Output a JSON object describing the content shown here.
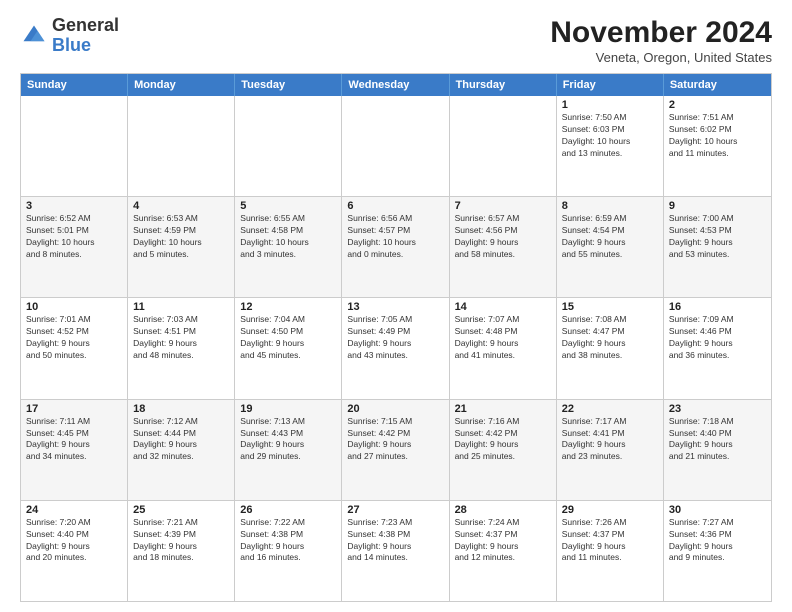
{
  "logo": {
    "general": "General",
    "blue": "Blue"
  },
  "title": "November 2024",
  "subtitle": "Veneta, Oregon, United States",
  "days": [
    "Sunday",
    "Monday",
    "Tuesday",
    "Wednesday",
    "Thursday",
    "Friday",
    "Saturday"
  ],
  "rows": [
    {
      "alt": false,
      "cells": [
        {
          "day": "",
          "info": ""
        },
        {
          "day": "",
          "info": ""
        },
        {
          "day": "",
          "info": ""
        },
        {
          "day": "",
          "info": ""
        },
        {
          "day": "",
          "info": ""
        },
        {
          "day": "1",
          "info": "Sunrise: 7:50 AM\nSunset: 6:03 PM\nDaylight: 10 hours\nand 13 minutes."
        },
        {
          "day": "2",
          "info": "Sunrise: 7:51 AM\nSunset: 6:02 PM\nDaylight: 10 hours\nand 11 minutes."
        }
      ]
    },
    {
      "alt": true,
      "cells": [
        {
          "day": "3",
          "info": "Sunrise: 6:52 AM\nSunset: 5:01 PM\nDaylight: 10 hours\nand 8 minutes."
        },
        {
          "day": "4",
          "info": "Sunrise: 6:53 AM\nSunset: 4:59 PM\nDaylight: 10 hours\nand 5 minutes."
        },
        {
          "day": "5",
          "info": "Sunrise: 6:55 AM\nSunset: 4:58 PM\nDaylight: 10 hours\nand 3 minutes."
        },
        {
          "day": "6",
          "info": "Sunrise: 6:56 AM\nSunset: 4:57 PM\nDaylight: 10 hours\nand 0 minutes."
        },
        {
          "day": "7",
          "info": "Sunrise: 6:57 AM\nSunset: 4:56 PM\nDaylight: 9 hours\nand 58 minutes."
        },
        {
          "day": "8",
          "info": "Sunrise: 6:59 AM\nSunset: 4:54 PM\nDaylight: 9 hours\nand 55 minutes."
        },
        {
          "day": "9",
          "info": "Sunrise: 7:00 AM\nSunset: 4:53 PM\nDaylight: 9 hours\nand 53 minutes."
        }
      ]
    },
    {
      "alt": false,
      "cells": [
        {
          "day": "10",
          "info": "Sunrise: 7:01 AM\nSunset: 4:52 PM\nDaylight: 9 hours\nand 50 minutes."
        },
        {
          "day": "11",
          "info": "Sunrise: 7:03 AM\nSunset: 4:51 PM\nDaylight: 9 hours\nand 48 minutes."
        },
        {
          "day": "12",
          "info": "Sunrise: 7:04 AM\nSunset: 4:50 PM\nDaylight: 9 hours\nand 45 minutes."
        },
        {
          "day": "13",
          "info": "Sunrise: 7:05 AM\nSunset: 4:49 PM\nDaylight: 9 hours\nand 43 minutes."
        },
        {
          "day": "14",
          "info": "Sunrise: 7:07 AM\nSunset: 4:48 PM\nDaylight: 9 hours\nand 41 minutes."
        },
        {
          "day": "15",
          "info": "Sunrise: 7:08 AM\nSunset: 4:47 PM\nDaylight: 9 hours\nand 38 minutes."
        },
        {
          "day": "16",
          "info": "Sunrise: 7:09 AM\nSunset: 4:46 PM\nDaylight: 9 hours\nand 36 minutes."
        }
      ]
    },
    {
      "alt": true,
      "cells": [
        {
          "day": "17",
          "info": "Sunrise: 7:11 AM\nSunset: 4:45 PM\nDaylight: 9 hours\nand 34 minutes."
        },
        {
          "day": "18",
          "info": "Sunrise: 7:12 AM\nSunset: 4:44 PM\nDaylight: 9 hours\nand 32 minutes."
        },
        {
          "day": "19",
          "info": "Sunrise: 7:13 AM\nSunset: 4:43 PM\nDaylight: 9 hours\nand 29 minutes."
        },
        {
          "day": "20",
          "info": "Sunrise: 7:15 AM\nSunset: 4:42 PM\nDaylight: 9 hours\nand 27 minutes."
        },
        {
          "day": "21",
          "info": "Sunrise: 7:16 AM\nSunset: 4:42 PM\nDaylight: 9 hours\nand 25 minutes."
        },
        {
          "day": "22",
          "info": "Sunrise: 7:17 AM\nSunset: 4:41 PM\nDaylight: 9 hours\nand 23 minutes."
        },
        {
          "day": "23",
          "info": "Sunrise: 7:18 AM\nSunset: 4:40 PM\nDaylight: 9 hours\nand 21 minutes."
        }
      ]
    },
    {
      "alt": false,
      "cells": [
        {
          "day": "24",
          "info": "Sunrise: 7:20 AM\nSunset: 4:40 PM\nDaylight: 9 hours\nand 20 minutes."
        },
        {
          "day": "25",
          "info": "Sunrise: 7:21 AM\nSunset: 4:39 PM\nDaylight: 9 hours\nand 18 minutes."
        },
        {
          "day": "26",
          "info": "Sunrise: 7:22 AM\nSunset: 4:38 PM\nDaylight: 9 hours\nand 16 minutes."
        },
        {
          "day": "27",
          "info": "Sunrise: 7:23 AM\nSunset: 4:38 PM\nDaylight: 9 hours\nand 14 minutes."
        },
        {
          "day": "28",
          "info": "Sunrise: 7:24 AM\nSunset: 4:37 PM\nDaylight: 9 hours\nand 12 minutes."
        },
        {
          "day": "29",
          "info": "Sunrise: 7:26 AM\nSunset: 4:37 PM\nDaylight: 9 hours\nand 11 minutes."
        },
        {
          "day": "30",
          "info": "Sunrise: 7:27 AM\nSunset: 4:36 PM\nDaylight: 9 hours\nand 9 minutes."
        }
      ]
    }
  ]
}
